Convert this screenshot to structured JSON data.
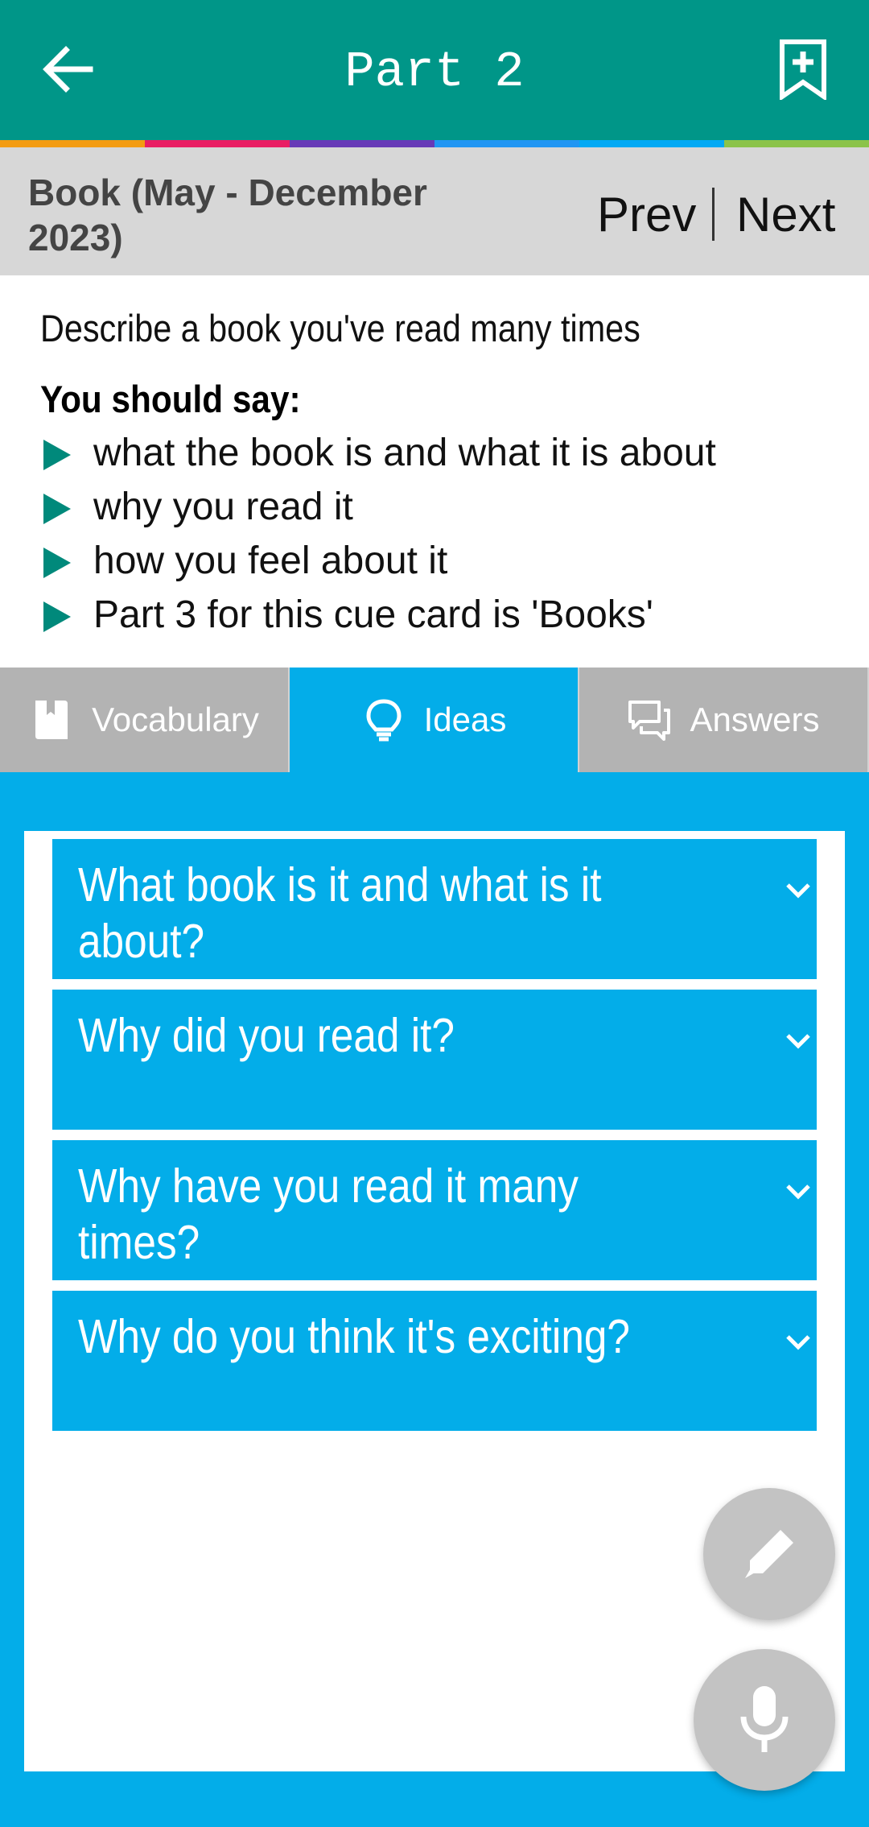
{
  "appbar": {
    "title": "Part 2",
    "back_icon": "arrow-left-icon",
    "bookmark_icon": "bookmark-plus-icon",
    "stripe_colors": [
      "#f39c12",
      "#e91e63",
      "#673ab7",
      "#2196f3",
      "#03a9f4",
      "#8bc34a"
    ]
  },
  "subheader": {
    "book_title": "Book (May - December 2023)",
    "prev_label": "Prev",
    "next_label": "Next"
  },
  "cue_card": {
    "description": "Describe a book you've read many times",
    "you_should_say": "You should say:",
    "bullets": [
      "what the book is and what it is about",
      "why you read it",
      "how you feel about it",
      "Part 3 for this cue card is 'Books'"
    ]
  },
  "tabs": [
    {
      "label": "Vocabulary",
      "icon": "book-icon",
      "active": false
    },
    {
      "label": "Ideas",
      "icon": "lightbulb-icon",
      "active": true
    },
    {
      "label": "Answers",
      "icon": "chat-icon",
      "active": false
    }
  ],
  "accordion": [
    {
      "question": "What book is it and what is it about?"
    },
    {
      "question": "Why did you read it?"
    },
    {
      "question": "Why have you read it many times?"
    },
    {
      "question": "Why do you think it's exciting?"
    }
  ],
  "fabs": {
    "edit_icon": "pencil-icon",
    "mic_icon": "microphone-icon"
  },
  "colors": {
    "primary": "#009688",
    "accent_blue": "#03ade9",
    "bullet_green": "#00897b",
    "tab_inactive": "#b3b3b3"
  }
}
